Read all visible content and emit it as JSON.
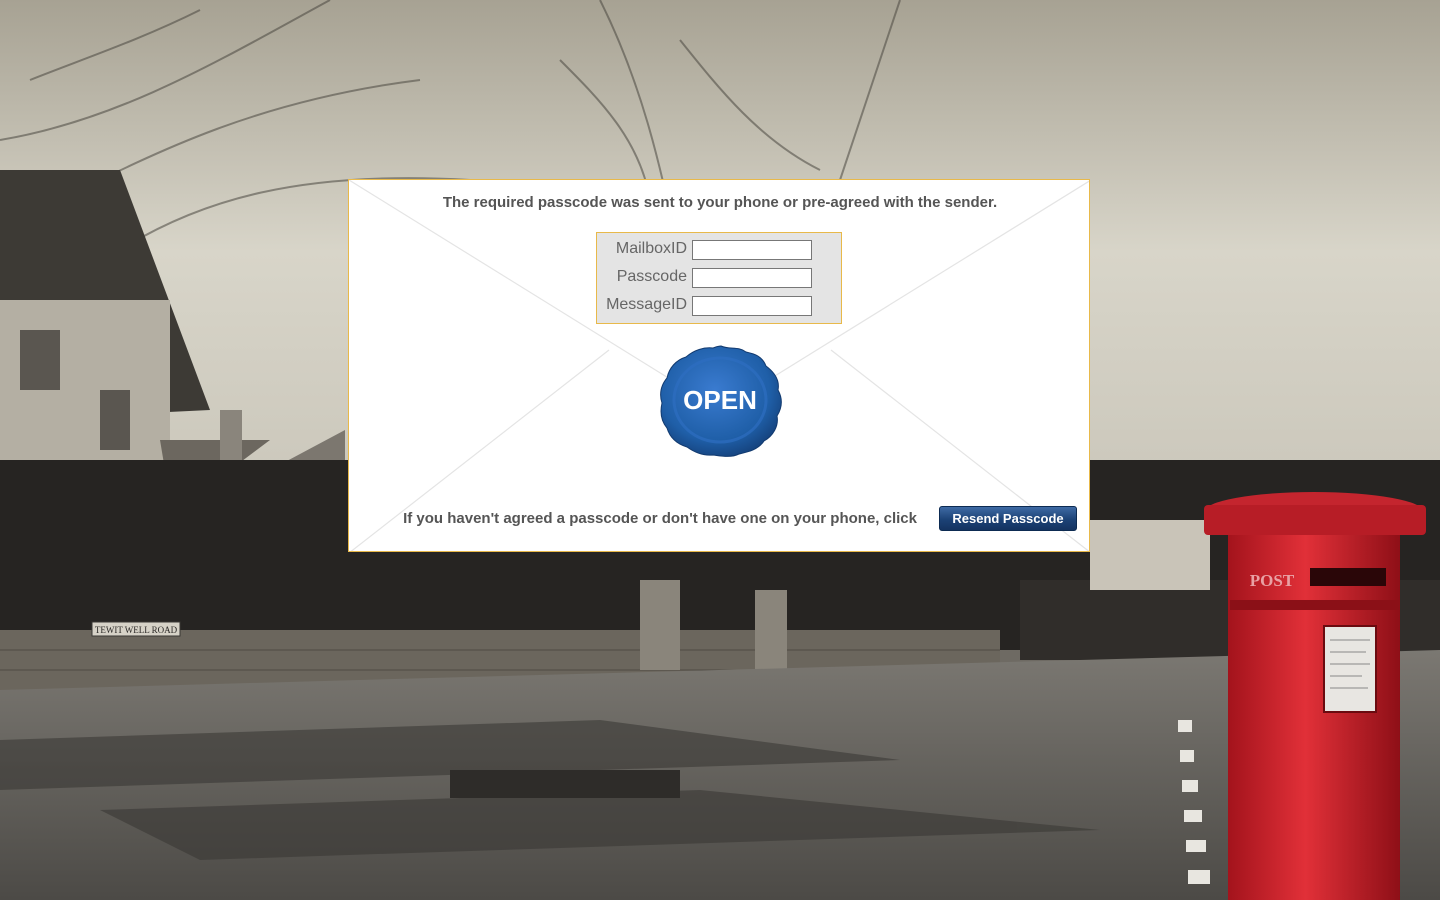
{
  "instruction_text": "The required passcode was sent to your phone or pre-agreed with the sender.",
  "form": {
    "fields": [
      {
        "label": "MailboxID",
        "value": "",
        "placeholder": ""
      },
      {
        "label": "Passcode",
        "value": "",
        "placeholder": ""
      },
      {
        "label": "MessageID",
        "value": "",
        "placeholder": ""
      }
    ]
  },
  "seal": {
    "label": "OPEN",
    "color": "#1f5fa8"
  },
  "resend": {
    "text": "If you haven't agreed a passcode or don't have one on your phone, click",
    "button_label": "Resend Passcode"
  },
  "background": {
    "street_sign": "TEWIT WELL ROAD",
    "postbox_text": "POST"
  },
  "colors": {
    "envelope_border": "#e8b94a",
    "button": "#1c4276",
    "postbox": "#c8202a"
  }
}
